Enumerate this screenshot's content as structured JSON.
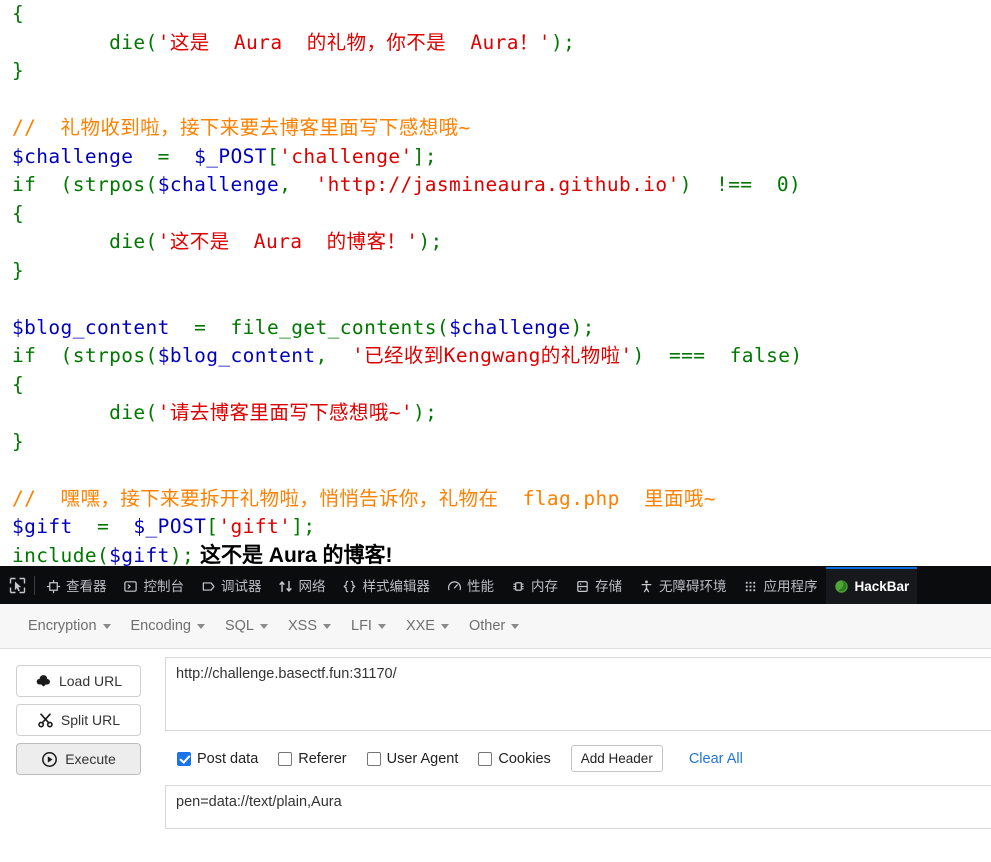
{
  "source_view": {
    "lines": [
      {
        "segments": [
          {
            "t": "{",
            "c": "kw"
          }
        ]
      },
      {
        "segments": [
          {
            "t": "        ",
            "c": "kw"
          },
          {
            "t": "die",
            "c": "kw"
          },
          {
            "t": "(",
            "c": "kw"
          },
          {
            "t": "'这是  Aura  的礼物，你不是  Aura！'",
            "c": "str"
          },
          {
            "t": ");",
            "c": "kw"
          }
        ]
      },
      {
        "segments": [
          {
            "t": "}",
            "c": "kw"
          }
        ]
      },
      {
        "segments": []
      },
      {
        "segments": [
          {
            "t": "//  礼物收到啦，接下来要去博客里面写下感想哦~",
            "c": "cmt"
          }
        ]
      },
      {
        "segments": [
          {
            "t": "$challenge",
            "c": "var"
          },
          {
            "t": "  =  ",
            "c": "kw"
          },
          {
            "t": "$_POST",
            "c": "var"
          },
          {
            "t": "[",
            "c": "kw"
          },
          {
            "t": "'challenge'",
            "c": "str"
          },
          {
            "t": "];",
            "c": "kw"
          }
        ]
      },
      {
        "segments": [
          {
            "t": "if",
            "c": "kw"
          },
          {
            "t": "  (",
            "c": "kw"
          },
          {
            "t": "strpos",
            "c": "kw"
          },
          {
            "t": "(",
            "c": "kw"
          },
          {
            "t": "$challenge",
            "c": "var"
          },
          {
            "t": ",  ",
            "c": "kw"
          },
          {
            "t": "'http://jasmineaura.github.io'",
            "c": "str"
          },
          {
            "t": ")  !==  0)",
            "c": "kw"
          }
        ]
      },
      {
        "segments": [
          {
            "t": "{",
            "c": "kw"
          }
        ]
      },
      {
        "segments": [
          {
            "t": "        ",
            "c": "kw"
          },
          {
            "t": "die",
            "c": "kw"
          },
          {
            "t": "(",
            "c": "kw"
          },
          {
            "t": "'这不是  Aura  的博客！'",
            "c": "str"
          },
          {
            "t": ");",
            "c": "kw"
          }
        ]
      },
      {
        "segments": [
          {
            "t": "}",
            "c": "kw"
          }
        ]
      },
      {
        "segments": []
      },
      {
        "segments": [
          {
            "t": "$blog_content",
            "c": "var"
          },
          {
            "t": "  =  ",
            "c": "kw"
          },
          {
            "t": "file_get_contents",
            "c": "kw"
          },
          {
            "t": "(",
            "c": "kw"
          },
          {
            "t": "$challenge",
            "c": "var"
          },
          {
            "t": ");",
            "c": "kw"
          }
        ]
      },
      {
        "segments": [
          {
            "t": "if",
            "c": "kw"
          },
          {
            "t": "  (",
            "c": "kw"
          },
          {
            "t": "strpos",
            "c": "kw"
          },
          {
            "t": "(",
            "c": "kw"
          },
          {
            "t": "$blog_content",
            "c": "var"
          },
          {
            "t": ",  ",
            "c": "kw"
          },
          {
            "t": "'已经收到Kengwang的礼物啦'",
            "c": "str"
          },
          {
            "t": ")  ===  false)",
            "c": "kw"
          }
        ]
      },
      {
        "segments": [
          {
            "t": "{",
            "c": "kw"
          }
        ]
      },
      {
        "segments": [
          {
            "t": "        ",
            "c": "kw"
          },
          {
            "t": "die",
            "c": "kw"
          },
          {
            "t": "(",
            "c": "kw"
          },
          {
            "t": "'请去博客里面写下感想哦~'",
            "c": "str"
          },
          {
            "t": ");",
            "c": "kw"
          }
        ]
      },
      {
        "segments": [
          {
            "t": "}",
            "c": "kw"
          }
        ]
      },
      {
        "segments": []
      },
      {
        "segments": [
          {
            "t": "//  嘿嘿，接下来要拆开礼物啦，悄悄告诉你，礼物在  flag.php  里面哦~",
            "c": "cmt"
          }
        ]
      },
      {
        "segments": [
          {
            "t": "$gift",
            "c": "var"
          },
          {
            "t": "  =  ",
            "c": "kw"
          },
          {
            "t": "$_POST",
            "c": "var"
          },
          {
            "t": "[",
            "c": "kw"
          },
          {
            "t": "'gift'",
            "c": "str"
          },
          {
            "t": "];",
            "c": "kw"
          }
        ]
      },
      {
        "segments": [
          {
            "t": "include",
            "c": "kw"
          },
          {
            "t": "(",
            "c": "kw"
          },
          {
            "t": "$gift",
            "c": "var"
          },
          {
            "t": ");",
            "c": "kw"
          },
          {
            "t": " 这不是 Aura 的博客!",
            "c": "html-out"
          }
        ]
      }
    ]
  },
  "devtools": {
    "picker_icon": "element-picker-icon",
    "tabs": [
      {
        "label": "查看器",
        "icon": "inspector-icon",
        "active": false
      },
      {
        "label": "控制台",
        "icon": "console-icon",
        "active": false
      },
      {
        "label": "调试器",
        "icon": "debugger-icon",
        "active": false
      },
      {
        "label": "网络",
        "icon": "network-icon",
        "active": false
      },
      {
        "label": "样式编辑器",
        "icon": "style-editor-icon",
        "active": false
      },
      {
        "label": "性能",
        "icon": "performance-icon",
        "active": false
      },
      {
        "label": "内存",
        "icon": "memory-icon",
        "active": false
      },
      {
        "label": "存储",
        "icon": "storage-icon",
        "active": false
      },
      {
        "label": "无障碍环境",
        "icon": "accessibility-icon",
        "active": false
      },
      {
        "label": "应用程序",
        "icon": "application-icon",
        "active": false
      },
      {
        "label": "HackBar",
        "icon": "hackbar-icon",
        "active": true
      }
    ],
    "active_tab_accent": "#0b6cda",
    "toolbar_bg": "#0b0c0e"
  },
  "hackbar": {
    "menu": [
      {
        "label": "Encryption"
      },
      {
        "label": "Encoding"
      },
      {
        "label": "SQL"
      },
      {
        "label": "XSS"
      },
      {
        "label": "LFI"
      },
      {
        "label": "XXE"
      },
      {
        "label": "Other"
      }
    ],
    "buttons": [
      {
        "label": "Load URL",
        "icon": "cloud-download-icon",
        "primary": false
      },
      {
        "label": "Split URL",
        "icon": "scissors-icon",
        "primary": false
      },
      {
        "label": "Execute",
        "icon": "play-circle-icon",
        "primary": true
      }
    ],
    "url_field": {
      "value": "http://challenge.basectf.fun:31170/",
      "placeholder": ""
    },
    "options": [
      {
        "label": "Post data",
        "checked": true
      },
      {
        "label": "Referer",
        "checked": false
      },
      {
        "label": "User Agent",
        "checked": false
      },
      {
        "label": "Cookies",
        "checked": false
      }
    ],
    "add_header_label": "Add Header",
    "clear_all_label": "Clear All",
    "clear_all_color": "#2176d2",
    "post_field": {
      "value": "pen=data://text/plain,Aura",
      "placeholder": ""
    }
  }
}
